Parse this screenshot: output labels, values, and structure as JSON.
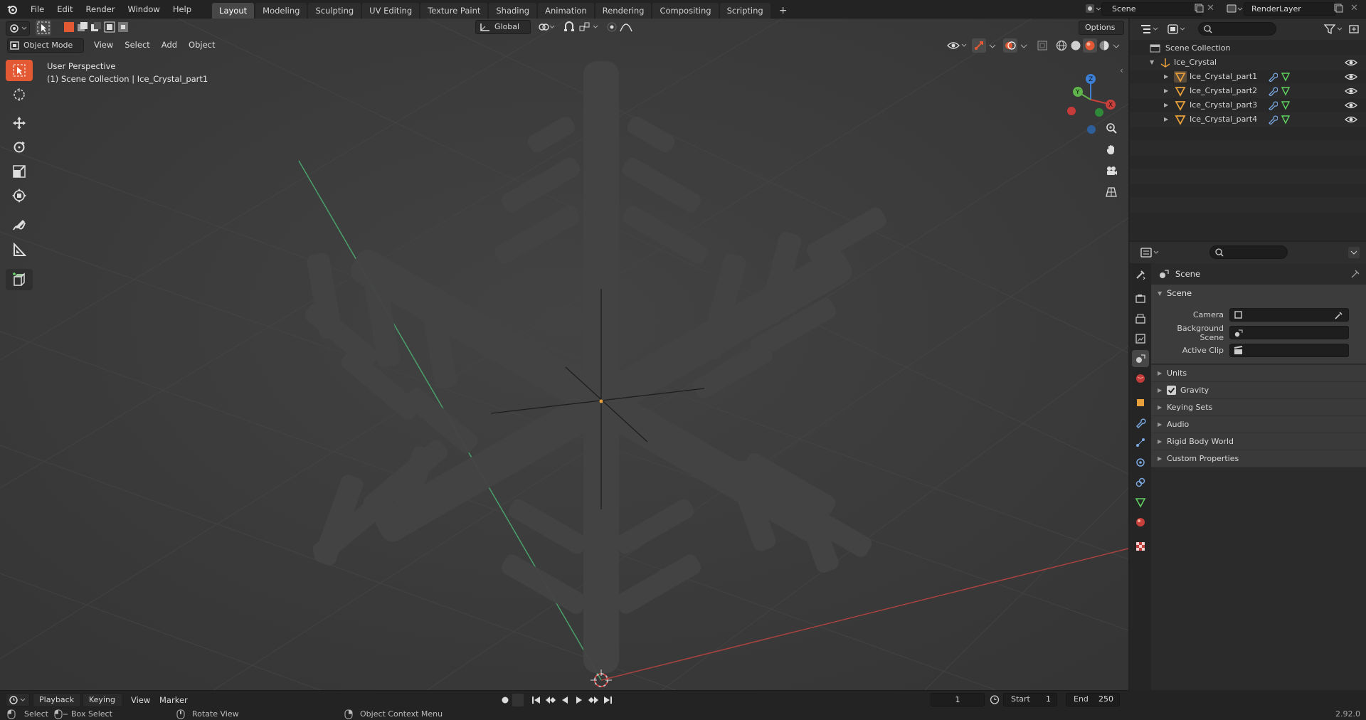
{
  "topbar": {
    "menus": [
      "File",
      "Edit",
      "Render",
      "Window",
      "Help"
    ],
    "workspaces": [
      "Layout",
      "Modeling",
      "Sculpting",
      "UV Editing",
      "Texture Paint",
      "Shading",
      "Animation",
      "Rendering",
      "Compositing",
      "Scripting"
    ],
    "active_workspace": "Layout",
    "add_workspace": "+",
    "scene_name": "Scene",
    "view_layer": "RenderLayer"
  },
  "viewport": {
    "mode": "Object Mode",
    "menus": [
      "View",
      "Select",
      "Add",
      "Object"
    ],
    "transform_orientation": "Global",
    "options_label": "Options",
    "info_line1": "User Perspective",
    "info_line2": "(1) Scene Collection | Ice_Crystal_part1",
    "gizmo": {
      "x": "X",
      "y": "Y",
      "z": "Z"
    }
  },
  "outliner": {
    "root": "Scene Collection",
    "collection": "Ice_Crystal",
    "objects": [
      "Ice_Crystal_part1",
      "Ice_Crystal_part2",
      "Ice_Crystal_part3",
      "Ice_Crystal_part4"
    ]
  },
  "properties": {
    "context": "Scene",
    "panel": "Scene",
    "fields": [
      {
        "label": "Camera"
      },
      {
        "label": "Background Scene"
      },
      {
        "label": "Active Clip"
      }
    ],
    "subpanels": [
      "Units",
      "Gravity",
      "Keying Sets",
      "Audio",
      "Rigid Body World",
      "Custom Properties"
    ],
    "gravity_checked": true
  },
  "timeline": {
    "menus": [
      "Playback",
      "Keying",
      "View",
      "Marker"
    ],
    "current_frame": "1",
    "start_label": "Start",
    "start_value": "1",
    "end_label": "End",
    "end_value": "250"
  },
  "statusbar": {
    "select": "Select",
    "box_select": "Box Select",
    "rotate_view": "Rotate View",
    "context_menu": "Object Context Menu",
    "version": "2.92.0"
  },
  "colors": {
    "accent": "#e35933",
    "x_axis": "#c8403c",
    "y_axis": "#5fb54b",
    "z_axis": "#3d7fd4",
    "mesh_orange": "#e8a03a"
  }
}
